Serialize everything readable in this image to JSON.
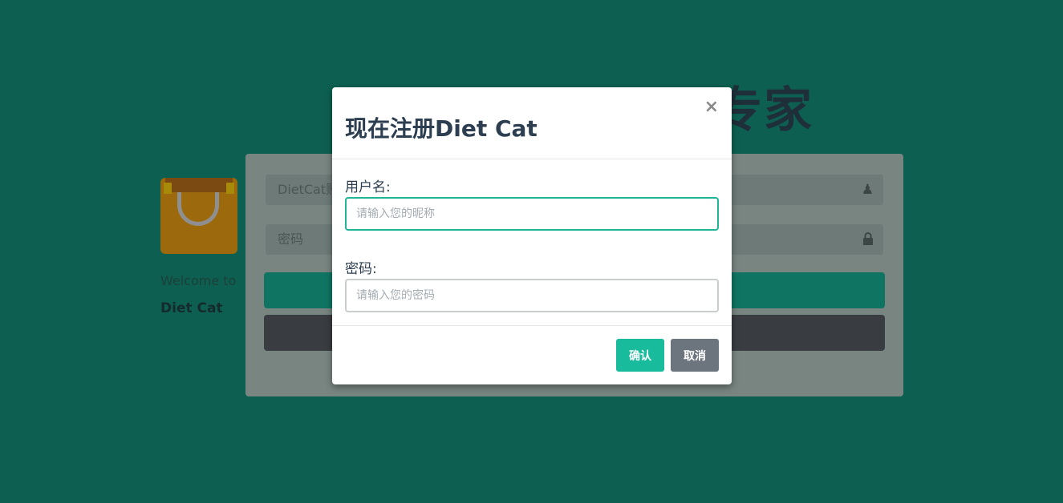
{
  "background": {
    "hero_title": "专家",
    "welcome_text": "Welcome to",
    "brand_name": "Diet Cat",
    "login": {
      "username_placeholder": "DietCat账",
      "password_placeholder": "密码",
      "user_icon": "user-icon",
      "lock_icon": "lock-icon"
    }
  },
  "modal": {
    "title": "现在注册Diet Cat",
    "close_symbol": "×",
    "username_label": "用户名:",
    "username_placeholder": "请输入您的昵称",
    "password_label": "密码:",
    "password_placeholder": "请输入您的密码",
    "confirm_label": "确认",
    "cancel_label": "取消"
  },
  "colors": {
    "page_background": "#0d6051",
    "accent": "#18bc9c",
    "cancel": "#6c757d",
    "title_text": "#2c3e50"
  }
}
